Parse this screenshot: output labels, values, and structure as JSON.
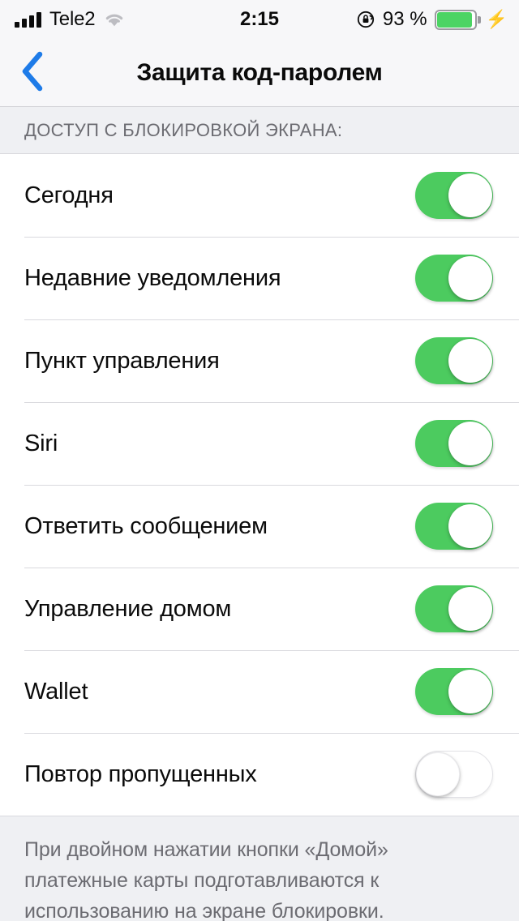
{
  "status_bar": {
    "carrier": "Tele2",
    "time": "2:15",
    "battery_percent": "93 %",
    "signal_icon": "signal-bars-icon",
    "wifi_icon": "wifi-icon",
    "rotation_lock_icon": "rotation-lock-icon",
    "battery_icon": "battery-icon",
    "charging_icon": "lightning-bolt-icon"
  },
  "nav": {
    "back_icon": "chevron-left-icon",
    "title": "Защита код-паролем",
    "accent_color": "#1e7be8"
  },
  "section": {
    "header": "ДОСТУП С БЛОКИРОВКОЙ ЭКРАНА:"
  },
  "rows": [
    {
      "label": "Сегодня",
      "state": "on"
    },
    {
      "label": "Недавние уведомления",
      "state": "on"
    },
    {
      "label": "Пункт управления",
      "state": "on"
    },
    {
      "label": "Siri",
      "state": "on"
    },
    {
      "label": "Ответить сообщением",
      "state": "on"
    },
    {
      "label": "Управление домом",
      "state": "on"
    },
    {
      "label": "Wallet",
      "state": "on"
    },
    {
      "label": "Повтор пропущенных",
      "state": "off"
    }
  ],
  "footer": {
    "text": "При двойном нажатии кнопки «Домой» платежные карты подготавливаются к использованию на экране блокировки."
  },
  "colors": {
    "toggle_on": "#4ccb5f",
    "toggle_off_track": "#ffffff",
    "background": "#ffffff",
    "grouped_background": "#eff0f3",
    "separator": "#d9d9de",
    "secondary_text": "#6c6c72"
  }
}
